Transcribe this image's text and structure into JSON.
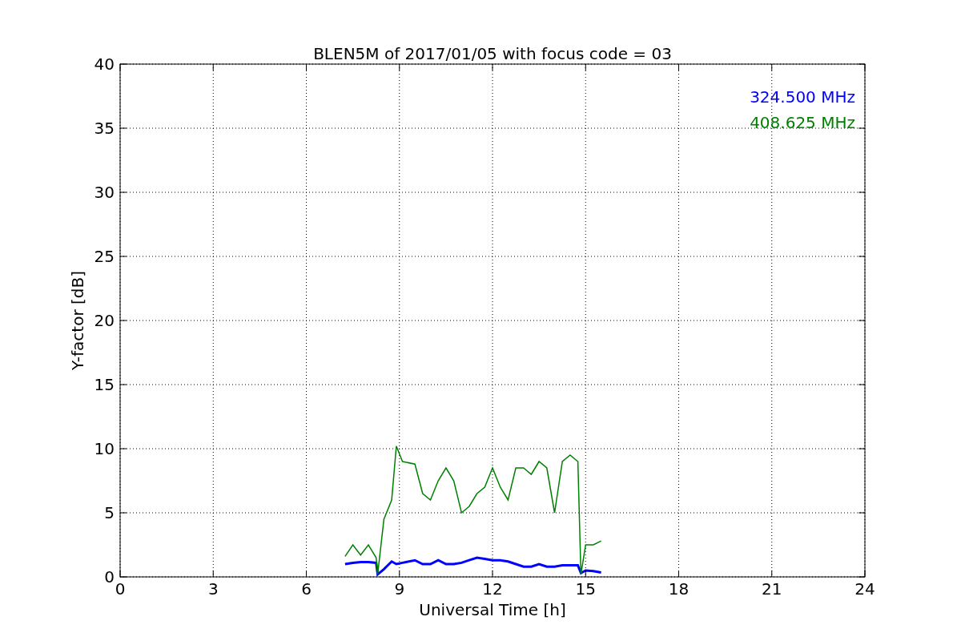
{
  "figure": {
    "chart_data": {
      "type": "line",
      "title": "BLEN5M of 2017/01/05 with focus code = 03",
      "xlabel": "Universal Time [h]",
      "ylabel": "Y-factor [dB]",
      "x": [
        7.25,
        7.5,
        7.75,
        8,
        8.25,
        8.3,
        8.5,
        8.75,
        8.9,
        9.1,
        9.5,
        9.75,
        10,
        10.25,
        10.5,
        10.75,
        11,
        11.25,
        11.5,
        11.75,
        12,
        12.25,
        12.5,
        12.75,
        13,
        13.25,
        13.5,
        13.75,
        14,
        14.25,
        14.5,
        14.75,
        14.85,
        15,
        15.25,
        15.5
      ],
      "series": [
        {
          "name": "324.500 MHz",
          "color": "#0000ff",
          "values": [
            1.0,
            1.1,
            1.15,
            1.15,
            1.1,
            0.2,
            0.6,
            1.2,
            1.0,
            1.1,
            1.3,
            1.0,
            1.0,
            1.3,
            1.0,
            1.0,
            1.1,
            1.3,
            1.5,
            1.4,
            1.3,
            1.3,
            1.2,
            1.0,
            0.8,
            0.8,
            1.0,
            0.8,
            0.8,
            0.9,
            0.9,
            0.9,
            0.3,
            0.5,
            0.45,
            0.35
          ]
        },
        {
          "name": "408.625 MHz",
          "color": "#008000",
          "values": [
            1.6,
            2.5,
            1.7,
            2.5,
            1.5,
            0.2,
            4.5,
            6.0,
            10.2,
            9.0,
            8.8,
            6.5,
            6.0,
            7.5,
            8.5,
            7.5,
            5.0,
            5.5,
            6.5,
            7.0,
            8.5,
            7.0,
            6.0,
            8.5,
            8.5,
            8.0,
            9.0,
            8.5,
            5.0,
            9.0,
            9.5,
            9.0,
            0.2,
            2.5,
            2.5,
            2.8
          ]
        }
      ],
      "xlim": [
        0,
        24
      ],
      "ylim": [
        0,
        40
      ],
      "xticks": [
        0,
        3,
        6,
        9,
        12,
        15,
        18,
        21,
        24
      ],
      "yticks": [
        0,
        5,
        10,
        15,
        20,
        25,
        30,
        35,
        40
      ],
      "grid": true
    }
  }
}
